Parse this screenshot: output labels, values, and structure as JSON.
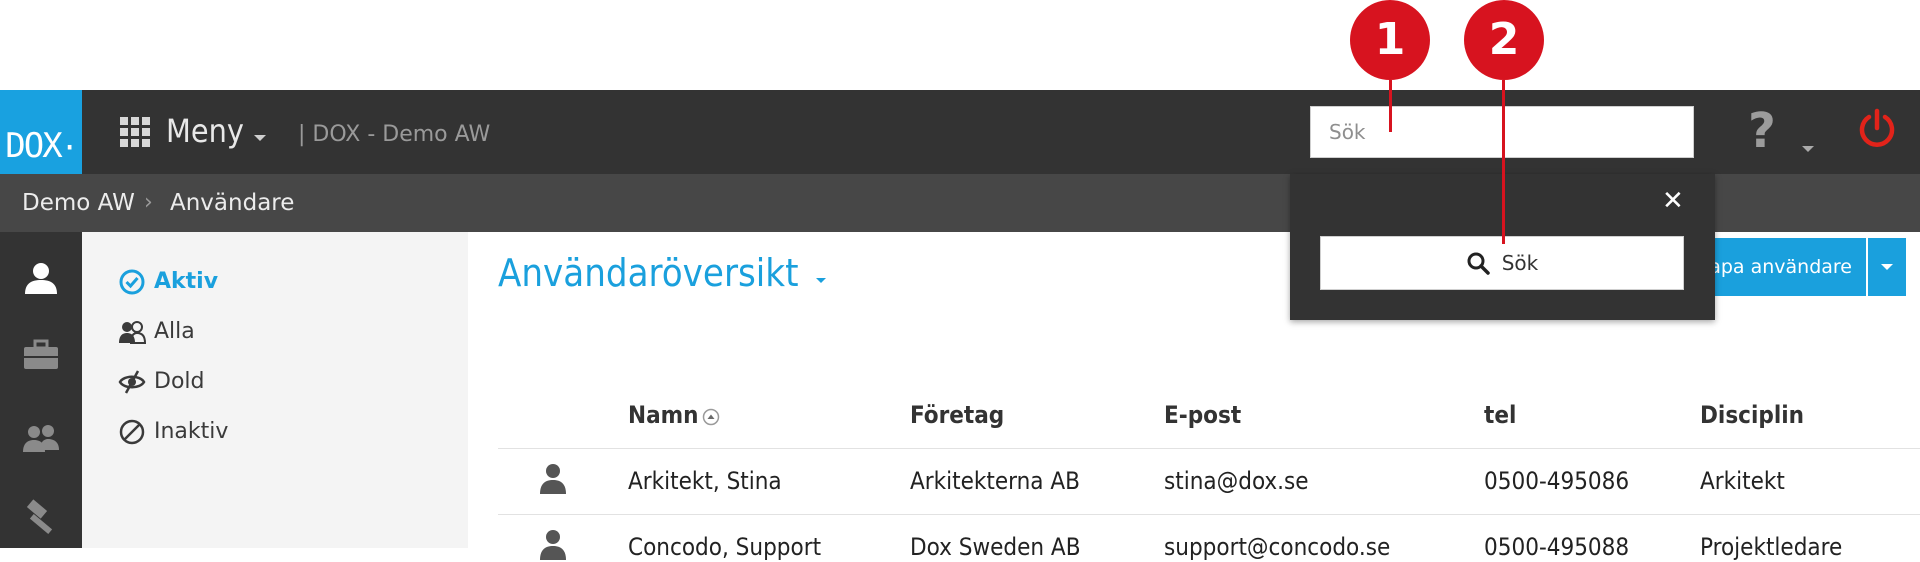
{
  "app": {
    "logo_text": "DOX",
    "menu_label": "Meny",
    "project_label": "| DOX - Demo AW",
    "brand_color": "#1aa0dd",
    "topbar_color": "#333333"
  },
  "header": {
    "search": {
      "placeholder": "Sök"
    },
    "help_label": "?",
    "icons": [
      "apps-grid-icon",
      "help-icon",
      "power-icon"
    ]
  },
  "breadcrumb": {
    "root": "Demo AW",
    "separator": "›",
    "current": "Användare"
  },
  "filters": {
    "items": [
      {
        "label": "Aktiv",
        "icon": "check-circle-icon",
        "active": true
      },
      {
        "label": "Alla",
        "icon": "users-icon",
        "active": false
      },
      {
        "label": "Dold",
        "icon": "eye-hidden-icon",
        "active": false
      },
      {
        "label": "Inaktiv",
        "icon": "blocked-icon",
        "active": false
      }
    ]
  },
  "main": {
    "title": "Användaröversikt",
    "create_button_label": "kapa användare"
  },
  "search_panel": {
    "close_label": "✕",
    "button_label": "Sök"
  },
  "table": {
    "columns": [
      "Namn",
      "Företag",
      "E-post",
      "tel",
      "Disciplin"
    ],
    "rows": [
      {
        "name": "Arkitekt, Stina",
        "company": "Arkitekterna AB",
        "email": "stina@dox.se",
        "tel": "0500-495086",
        "discipline": "Arkitekt"
      },
      {
        "name": "Concodo, Support",
        "company": "Dox Sweden AB",
        "email": "support@concodo.se",
        "tel": "0500-495088",
        "discipline": "Projektledare"
      }
    ]
  },
  "annotations": {
    "marker_1": "1",
    "marker_2": "2",
    "color": "#d7131f"
  }
}
